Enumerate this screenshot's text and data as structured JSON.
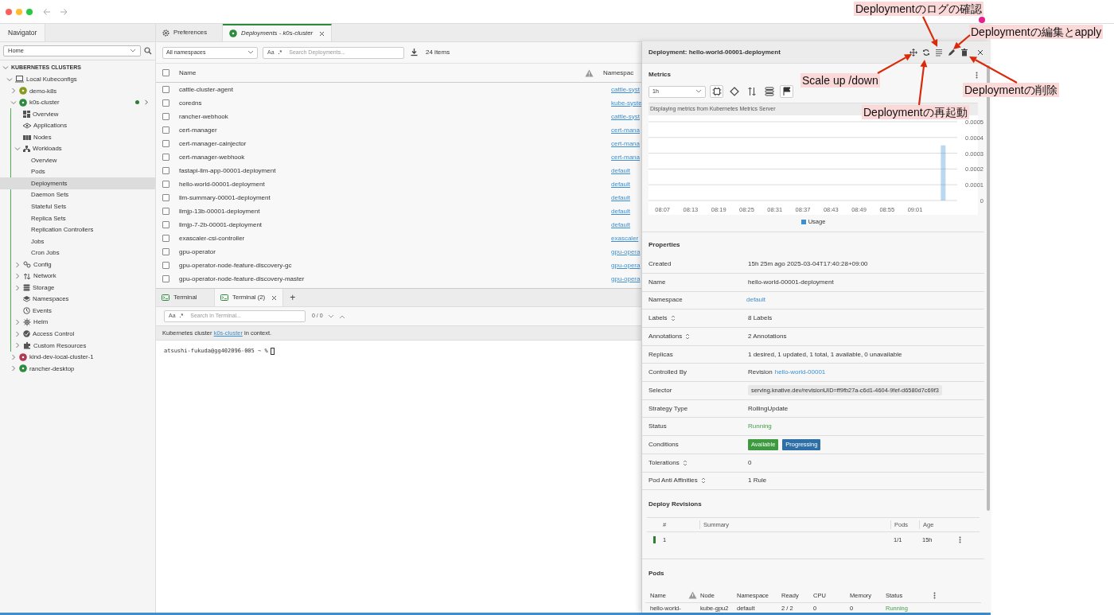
{
  "navigator": {
    "tab": "Navigator",
    "location": "Home",
    "tree": [
      {
        "label": "KUBERNETES CLUSTERS",
        "kind": "heading",
        "expanded": true,
        "selected": false,
        "children": [
          {
            "label": "Local Kubeconfigs",
            "kind": "computer",
            "expanded": true,
            "selected": false,
            "children": [
              {
                "label": "demo-k8s",
                "kind": "cluster",
                "color": "#8a9a1e",
                "expanded": false,
                "selected": false
              },
              {
                "label": "k0s-cluster",
                "kind": "cluster",
                "color": "#2e8b3e",
                "connected": true,
                "expanded": true,
                "selected": false,
                "children": [
                  {
                    "label": "Overview",
                    "kind": "overview",
                    "selected": false
                  },
                  {
                    "label": "Applications",
                    "kind": "applications",
                    "selected": false
                  },
                  {
                    "label": "Nodes",
                    "kind": "nodes",
                    "selected": false
                  },
                  {
                    "label": "Workloads",
                    "kind": "workloads",
                    "expanded": true,
                    "selected": false,
                    "children": [
                      {
                        "label": "Overview",
                        "kind": "plain",
                        "selected": false
                      },
                      {
                        "label": "Pods",
                        "kind": "plain",
                        "selected": false
                      },
                      {
                        "label": "Deployments",
                        "kind": "plain",
                        "selected": true
                      },
                      {
                        "label": "Daemon Sets",
                        "kind": "plain",
                        "selected": false
                      },
                      {
                        "label": "Stateful Sets",
                        "kind": "plain",
                        "selected": false
                      },
                      {
                        "label": "Replica Sets",
                        "kind": "plain",
                        "selected": false
                      },
                      {
                        "label": "Replication Controllers",
                        "kind": "plain",
                        "selected": false
                      },
                      {
                        "label": "Jobs",
                        "kind": "plain",
                        "selected": false
                      },
                      {
                        "label": "Cron Jobs",
                        "kind": "plain",
                        "selected": false
                      }
                    ]
                  },
                  {
                    "label": "Config",
                    "kind": "config",
                    "expanded": false,
                    "selected": false
                  },
                  {
                    "label": "Network",
                    "kind": "network",
                    "expanded": false,
                    "selected": false
                  },
                  {
                    "label": "Storage",
                    "kind": "storage",
                    "expanded": false,
                    "selected": false
                  },
                  {
                    "label": "Namespaces",
                    "kind": "namespaces",
                    "selected": false
                  },
                  {
                    "label": "Events",
                    "kind": "events",
                    "selected": false
                  },
                  {
                    "label": "Helm",
                    "kind": "helm",
                    "expanded": false,
                    "selected": false
                  },
                  {
                    "label": "Access Control",
                    "kind": "access",
                    "expanded": false,
                    "selected": false
                  },
                  {
                    "label": "Custom Resources",
                    "kind": "custom",
                    "expanded": false,
                    "selected": false
                  }
                ]
              },
              {
                "label": "kind-dev-local-cluster-1",
                "kind": "cluster",
                "color": "#b03a55",
                "expanded": false,
                "selected": false
              },
              {
                "label": "rancher-desktop",
                "kind": "cluster",
                "color": "#2e8b3e",
                "expanded": false,
                "selected": false
              }
            ]
          }
        ]
      }
    ]
  },
  "tabs": [
    {
      "label": "Preferences",
      "kind": "settings",
      "selected": false,
      "closable": false
    },
    {
      "label": "Deployments - k0s-cluster",
      "kind": "cluster",
      "selected": true,
      "closable": true
    }
  ],
  "toolbar": {
    "namespace_filter": "All namespaces",
    "match_case": "Aa",
    "regex": ".*",
    "search_placeholder": "Search Deployments...",
    "count": "24 items"
  },
  "table": {
    "columns": [
      "Name",
      "Namespac"
    ],
    "select_all_checked": false,
    "rows": [
      {
        "name": "cattle-cluster-agent",
        "namespace": "cattle-syst",
        "checked": false
      },
      {
        "name": "coredns",
        "namespace": "kube-syste",
        "checked": false
      },
      {
        "name": "rancher-webhook",
        "namespace": "cattle-syst",
        "checked": false
      },
      {
        "name": "cert-manager",
        "namespace": "cert-mana",
        "checked": false
      },
      {
        "name": "cert-manager-cainjector",
        "namespace": "cert-mana",
        "checked": false
      },
      {
        "name": "cert-manager-webhook",
        "namespace": "cert-mana",
        "checked": false
      },
      {
        "name": "fastapi-llm-app-00001-deployment",
        "namespace": "default",
        "checked": false
      },
      {
        "name": "hello-world-00001-deployment",
        "namespace": "default",
        "checked": false
      },
      {
        "name": "llm-summary-00001-deployment",
        "namespace": "default",
        "checked": false
      },
      {
        "name": "llmjp-13b-00001-deployment",
        "namespace": "default",
        "checked": false
      },
      {
        "name": "llmjp-7-2b-00001-deployment",
        "namespace": "default",
        "checked": false
      },
      {
        "name": "exascaler-csi-controller",
        "namespace": "exascaler",
        "checked": false
      },
      {
        "name": "gpu-operator",
        "namespace": "gpu-opera",
        "checked": false
      },
      {
        "name": "gpu-operator-node-feature-discovery-gc",
        "namespace": "gpu-opera",
        "checked": false
      },
      {
        "name": "gpu-operator-node-feature-discovery-master",
        "namespace": "gpu-opera",
        "checked": false
      }
    ]
  },
  "terminal": {
    "tabs": [
      {
        "label": "Terminal",
        "selected": false,
        "closable": false
      },
      {
        "label": "Terminal (2)",
        "selected": true,
        "closable": true
      }
    ],
    "add": "+",
    "match_case": "Aa",
    "regex": ".*",
    "search_placeholder": "Search in Terminal...",
    "matches": "0 / 0",
    "info_parts": [
      "Kubernetes cluster",
      "k0s-cluster",
      "in context."
    ],
    "prompt": "atsushi-fukuda@gg402096-005 ~ %"
  },
  "details": {
    "title": "Deployment: hello-world-00001-deployment",
    "metrics": {
      "title": "Metrics",
      "range": "1h",
      "note": "Displaying metrics from Kubernetes Metrics Server",
      "chart_data": {
        "type": "bar",
        "grid": true,
        "categories": [
          "08:07",
          "08:13",
          "08:19",
          "08:25",
          "08:31",
          "08:37",
          "08:43",
          "08:49",
          "08:55",
          "09:01",
          null
        ],
        "ylim": [
          0,
          0.0005
        ],
        "yticks": [
          0,
          0.0001,
          0.0002,
          0.0003,
          0.0004,
          0.0005
        ],
        "series": [
          {
            "name": "Usage",
            "color": "#3b8fd6",
            "values": [
              null,
              null,
              null,
              null,
              null,
              null,
              null,
              null,
              null,
              null,
              0.00035
            ]
          }
        ]
      }
    },
    "properties_title": "Properties",
    "properties": [
      {
        "label": "Created",
        "value": "15h 25m ago 2025-03-04T17:40:28+09:00",
        "kind": "text"
      },
      {
        "label": "Name",
        "value": "hello-world-00001-deployment",
        "kind": "text"
      },
      {
        "label": "Namespace",
        "value": "default",
        "kind": "link"
      },
      {
        "label": "Labels",
        "value": "8 Labels",
        "kind": "text",
        "expandable": true
      },
      {
        "label": "Annotations",
        "value": "2 Annotations",
        "kind": "text",
        "expandable": true
      },
      {
        "label": "Replicas",
        "value": "1 desired, 1 updated, 1 total, 1 available, 0 unavailable",
        "kind": "text"
      },
      {
        "label": "Controlled By",
        "prefix": "Revision",
        "value": "hello-world-00001",
        "kind": "link"
      },
      {
        "label": "Selector",
        "value": "serving.knative.dev/revisionUID=ff9fb27a-c6d1-4604-9fef-d6580d7c69f3",
        "kind": "chip"
      },
      {
        "label": "Strategy Type",
        "value": "RollingUpdate",
        "kind": "text"
      },
      {
        "label": "Status",
        "value": "Running",
        "kind": "status"
      },
      {
        "label": "Conditions",
        "kind": "badges",
        "badges": [
          {
            "text": "Available",
            "color": "#3d9a3f"
          },
          {
            "text": "Progressing",
            "color": "#2f6fa8"
          }
        ]
      },
      {
        "label": "Tolerations",
        "value": "0",
        "kind": "text",
        "expandable": true
      },
      {
        "label": "Pod Anti Affinities",
        "value": "1 Rule",
        "kind": "text",
        "expandable": true
      }
    ],
    "revisions": {
      "title": "Deploy Revisions",
      "columns": [
        "#",
        "Summary",
        "Pods",
        "Age"
      ],
      "rows": [
        {
          "number": "1",
          "pods": "1/1",
          "age": "15h",
          "color": "#2e7d32"
        }
      ]
    },
    "pods": {
      "title": "Pods",
      "columns": [
        "Name",
        "Node",
        "Namespace",
        "Ready",
        "CPU",
        "Memory",
        "Status"
      ],
      "rows": [
        {
          "name": "hello-world-",
          "node": "kube-gpu2",
          "namespace": "default",
          "ready": "2 / 2",
          "cpu": "0",
          "memory": "0",
          "status": "Running"
        }
      ]
    }
  },
  "annotations": [
    "Deploymentのログの確認",
    "Deploymentの編集とapply",
    "Scale up /down",
    "Deploymentの削除",
    "Deploymentの再起動"
  ]
}
